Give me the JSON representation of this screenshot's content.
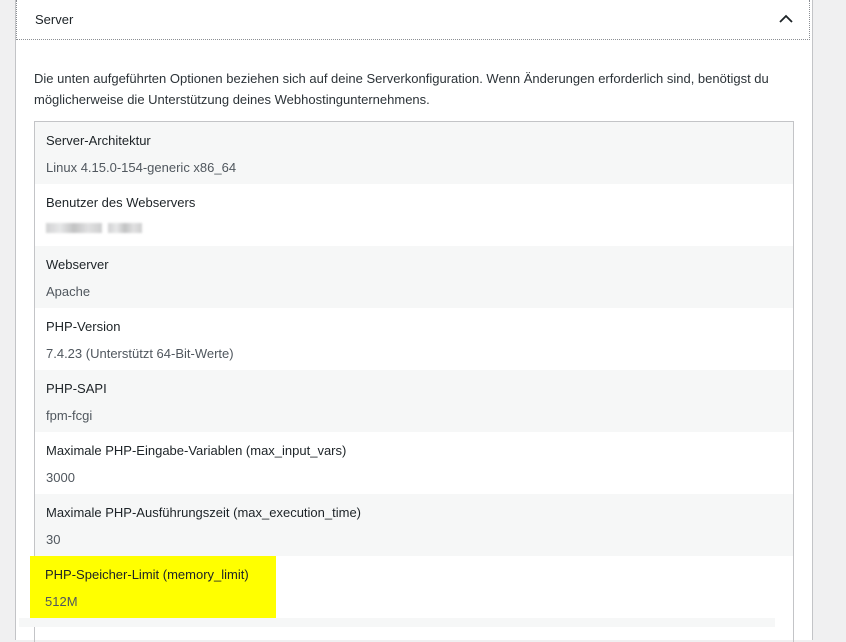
{
  "section": {
    "title": "Server",
    "expanded_icon": "chevron-up-icon",
    "description": "Die unten aufgeführten Optionen beziehen sich auf deine Serverkonfiguration. Wenn Änderungen erforderlich sind, benötigst du möglicherweise die Unterstützung deines Webhostingunternehmens."
  },
  "rows": [
    {
      "label": "Server-Architektur",
      "value": "Linux 4.15.0-154-generic x86_64"
    },
    {
      "label": "Benutzer des Webservers",
      "value": ""
    },
    {
      "label": "Webserver",
      "value": "Apache"
    },
    {
      "label": "PHP-Version",
      "value": "7.4.23 (Unterstützt 64-Bit-Werte)"
    },
    {
      "label": "PHP-SAPI",
      "value": "fpm-fcgi"
    },
    {
      "label": "Maximale PHP-Eingabe-Variablen (max_input_vars)",
      "value": "3000"
    },
    {
      "label": "Maximale PHP-Ausführungszeit (max_execution_time)",
      "value": "30"
    },
    {
      "label": "PHP-Speicher-Limit (memory_limit)",
      "value": "512M"
    }
  ],
  "colors": {
    "highlight": "#ffff00",
    "row_alt": "#f6f7f7",
    "border": "#c3c4c7"
  }
}
